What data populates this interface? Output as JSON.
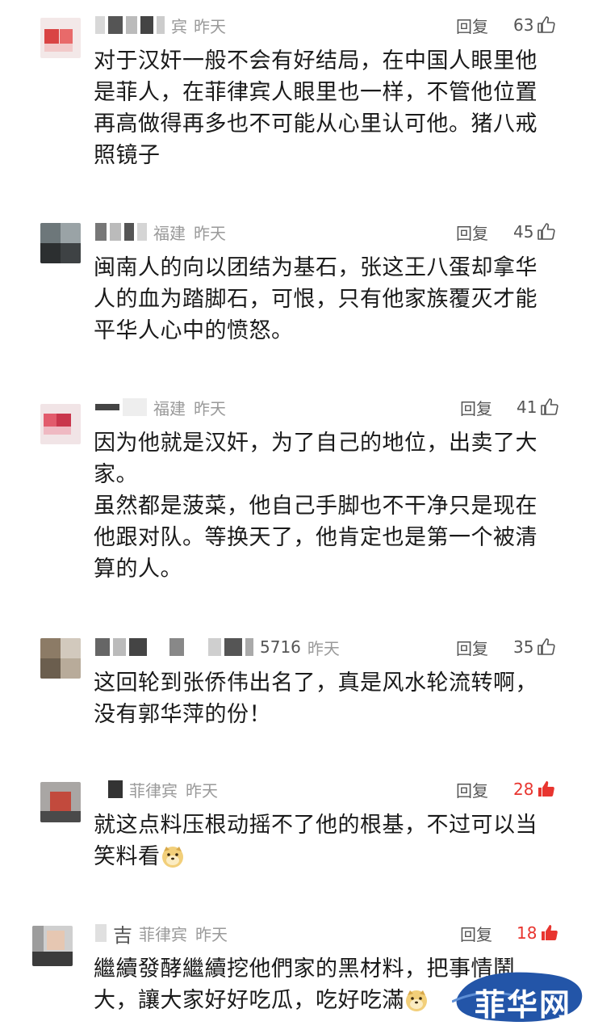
{
  "colors": {
    "hot_like": "#e8352f",
    "meta_gray": "#9a9a9a",
    "text": "#1a1a1a",
    "watermark_blue": "#2355a8"
  },
  "reply_label": "回复",
  "comments": [
    {
      "name_visible": "宾",
      "location": "",
      "time": "昨天",
      "likes": "63",
      "liked": false,
      "text": "对于汉奸一般不会有好结局，在中国人眼里他\n是菲人，在菲律宾人眼里也一样，不管他位置\n再高做得再多也不可能从心里认可他。猪八戒\n照镜子"
    },
    {
      "name_visible": "",
      "location": "福建",
      "time": "昨天",
      "likes": "45",
      "liked": false,
      "text": "闽南人的向以团结为基石，张这王八蛋却拿华\n人的血为踏脚石，可恨，只有他家族覆灭才能\n平华人心中的愤怒。"
    },
    {
      "name_visible": "",
      "location": "福建",
      "time": "昨天",
      "likes": "41",
      "liked": false,
      "text": "因为他就是汉奸，为了自己的地位，出卖了大\n家。\n虽然都是菠菜，他自己手脚也不干净只是现在\n他跟对队。等换天了，他肯定也是第一个被清\n算的人。"
    },
    {
      "name_visible": "5716",
      "location": "",
      "time": "昨天",
      "likes": "35",
      "liked": false,
      "text": "这回轮到张侨伟出名了，真是风水轮流转啊，\n没有郭华萍的份！"
    },
    {
      "name_visible": "",
      "location": "菲律宾",
      "time": "昨天",
      "likes": "28",
      "liked": true,
      "text": "就这点料压根动摇不了他的根基，不过可以当\n笑料看",
      "emoji": "doge-emoji"
    },
    {
      "name_visible": "吉",
      "location": "菲律宾",
      "time": "昨天",
      "likes": "18",
      "liked": true,
      "text": "繼續發酵繼續挖他們家的黑材料，把事情鬧\n大，讓大家好好吃瓜，吃好吃滿",
      "emoji": "doge-emoji"
    }
  ],
  "watermark": {
    "text": "菲华网"
  }
}
